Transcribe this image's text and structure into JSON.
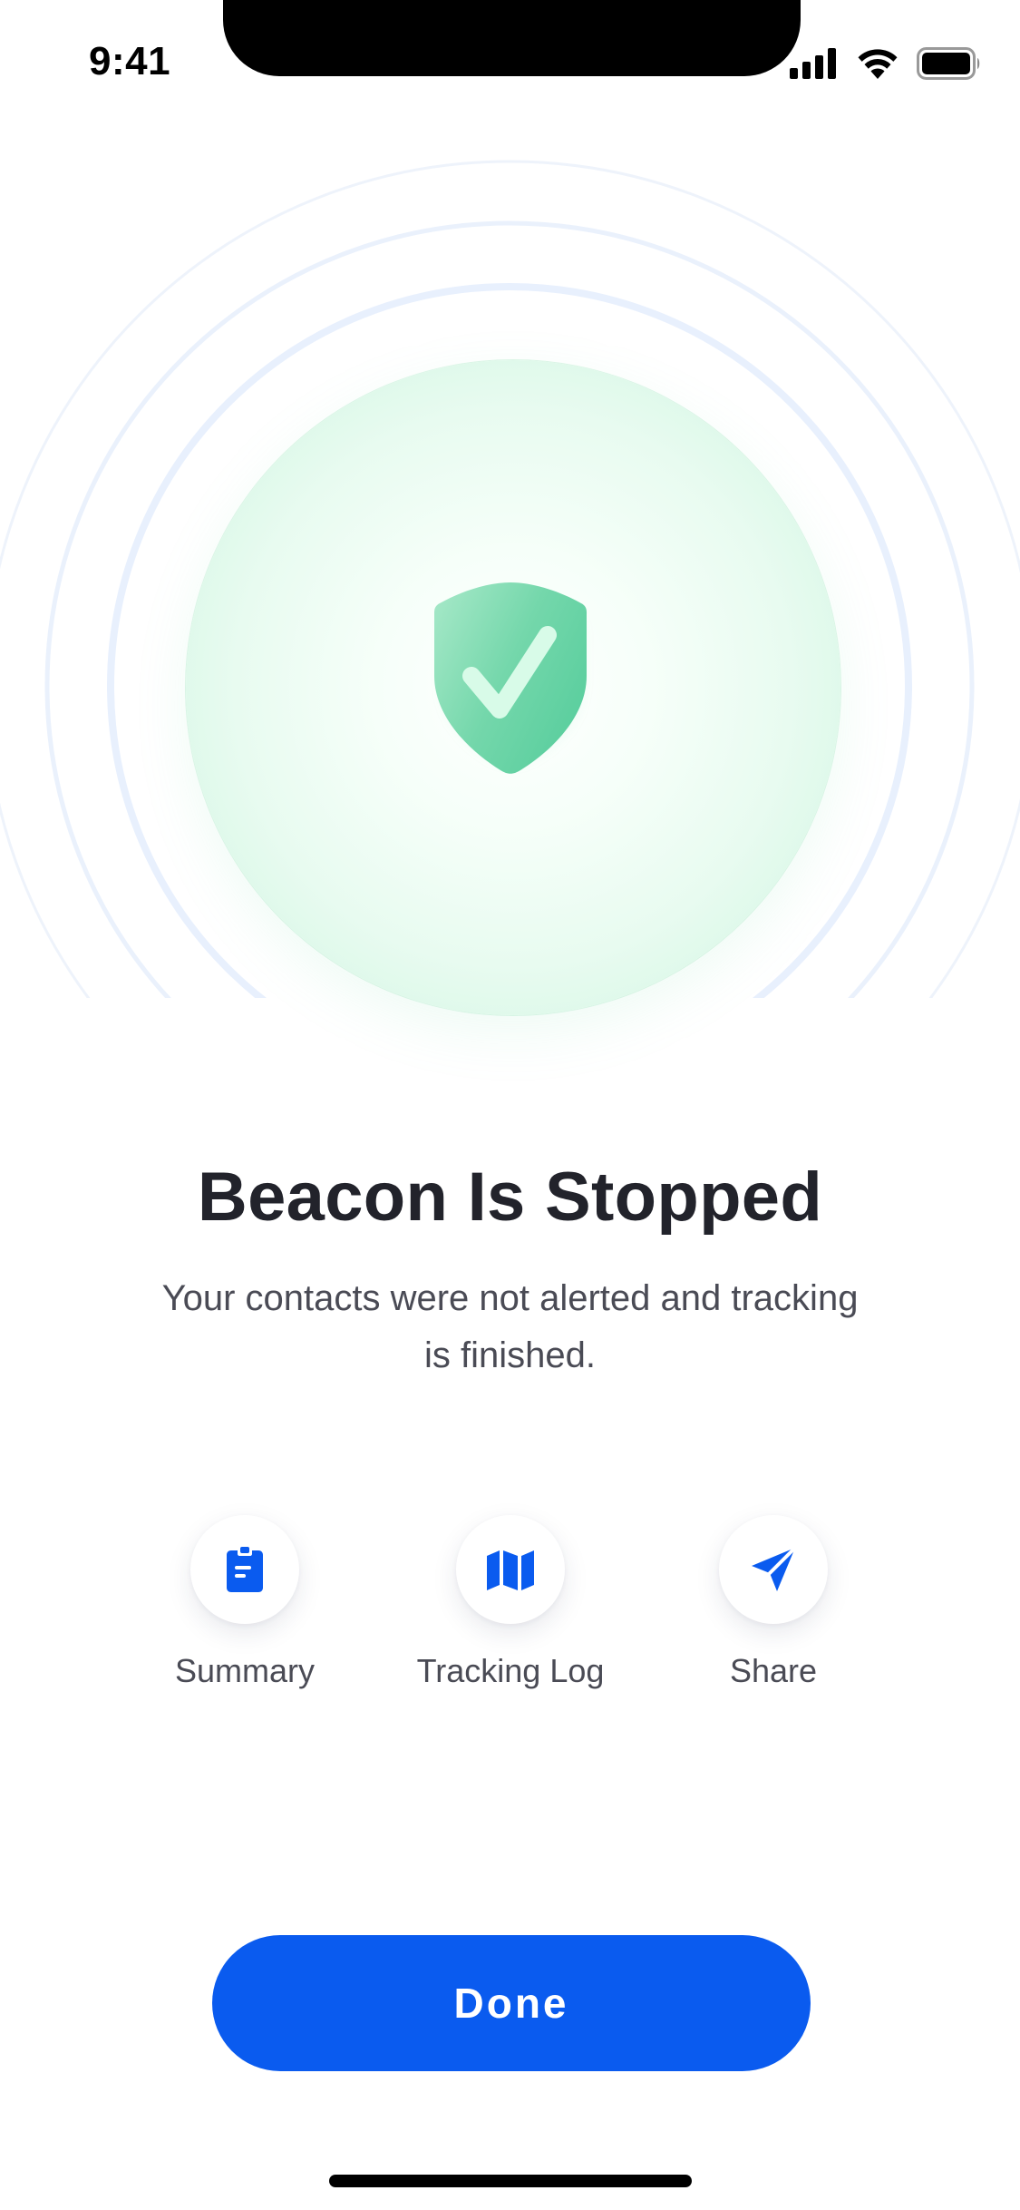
{
  "status_bar": {
    "time": "9:41"
  },
  "hero": {
    "icon": "shield-check-icon",
    "accent_color": "#5ccf9f"
  },
  "title": "Beacon Is Stopped",
  "subtitle": "Your contacts were not alerted and tracking is finished.",
  "actions": [
    {
      "label": "Summary",
      "icon": "clipboard-icon"
    },
    {
      "label": "Tracking Log",
      "icon": "map-icon"
    },
    {
      "label": "Share",
      "icon": "send-icon"
    }
  ],
  "done_button": {
    "label": "Done",
    "color": "#0a5bef"
  }
}
